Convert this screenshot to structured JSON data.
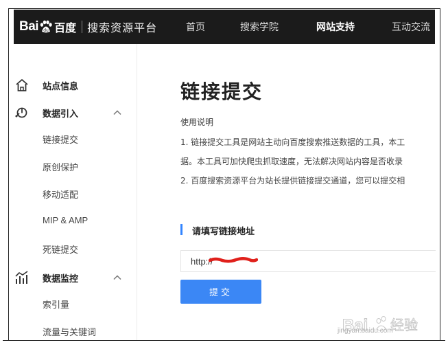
{
  "header": {
    "logo_text_a": "Bai",
    "logo_text_b": "百度",
    "platform_name": "搜索资源平台",
    "nav": [
      {
        "label": "首页",
        "active": false
      },
      {
        "label": "搜索学院",
        "active": false
      },
      {
        "label": "网站支持",
        "active": true
      },
      {
        "label": "互动交流",
        "active": false
      }
    ]
  },
  "sidebar": {
    "groups": [
      {
        "label": "站点信息",
        "icon": "home-icon",
        "expanded": false,
        "items": []
      },
      {
        "label": "数据引入",
        "icon": "data-import-icon",
        "expanded": true,
        "items": [
          "链接提交",
          "原创保护",
          "移动适配",
          "MIP & AMP",
          "死链提交"
        ]
      },
      {
        "label": "数据监控",
        "icon": "chart-icon",
        "expanded": true,
        "items": [
          "索引量",
          "流量与关键词"
        ]
      }
    ]
  },
  "main": {
    "title": "链接提交",
    "usage_title": "使用说明",
    "usage_lines": [
      "1. 链接提交工具是网站主动向百度搜索推送数据的工具，本工",
      "据。本工具可加快爬虫抓取速度，无法解决网站内容是否收录",
      "2. 百度搜索资源平台为站长提供链接提交通道，您可以提交相"
    ],
    "section_title": "请填写链接地址",
    "url_value": "http://",
    "submit_label": "提交"
  },
  "watermark": {
    "text": "jingyan.baidu.com"
  },
  "colors": {
    "topbar": "#1b1b1b",
    "accent": "#3385ff",
    "button": "#3b87f5",
    "redact": "#e0201b"
  }
}
